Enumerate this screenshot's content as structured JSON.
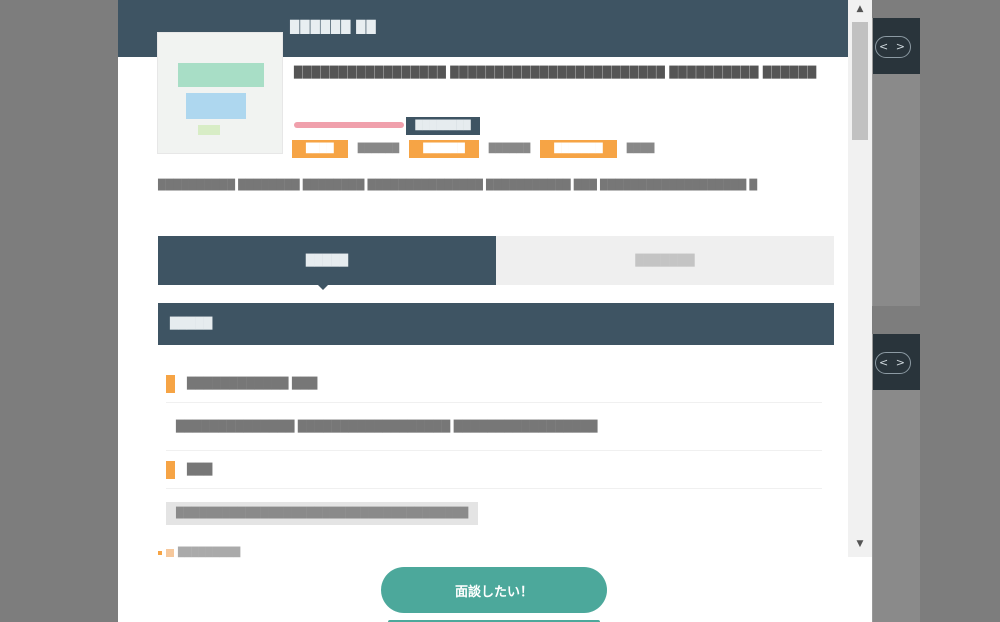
{
  "background_cards": {
    "pager_label": "< >"
  },
  "modal": {
    "header_title": "██████ ██",
    "thumbnail_alt": "",
    "job_title": "█████████████████ ████████████████████████ ██████████ ██████",
    "salary_badge": "████████",
    "tags": [
      {
        "label": "████",
        "style": "orange"
      },
      {
        "label": "██████",
        "style": "text"
      },
      {
        "label": "██████",
        "style": "orange"
      },
      {
        "label": "██████",
        "style": "text"
      },
      {
        "label": "███████",
        "style": "orange"
      },
      {
        "label": "████",
        "style": "text"
      }
    ],
    "lead_text": "██████████ ████████ ████████ ███████████████ ███████████ ███ ███████████████████ █",
    "tabs": [
      {
        "label": "█████"
      },
      {
        "label": "███████"
      }
    ],
    "section_title": "█████",
    "rows": [
      {
        "label": "████████████ ███",
        "marker": true
      },
      {
        "label": "██████████████ ██████████████████ █████████████████",
        "marker": false
      },
      {
        "label": "███",
        "marker": true
      },
      {
        "label": "██████████████████████████████████████",
        "gray_box": true
      }
    ],
    "cut_row_text": "█████████",
    "cta_label": "面談したい！"
  },
  "colors": {
    "header": "#3e5463",
    "accent_orange": "#f6a445",
    "cta": "#4ca89b",
    "overlay": "#7d7d7d"
  }
}
